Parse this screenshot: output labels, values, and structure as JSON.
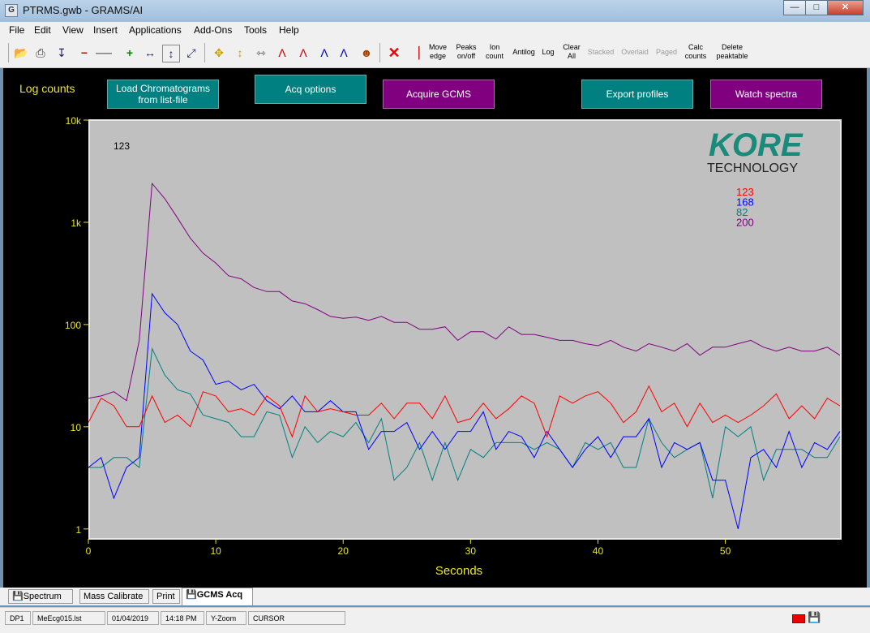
{
  "window": {
    "title": "PTRMS.gwb - GRAMS/AI",
    "app_icon": "G"
  },
  "menu": [
    "File",
    "Edit",
    "View",
    "Insert",
    "Applications",
    "Add-Ons",
    "Tools",
    "Help"
  ],
  "toolbar": {
    "move_edge": "Move edge",
    "peaks": "Peaks on/off",
    "ion_count": "Ion count",
    "antilog": "Antilog",
    "log": "Log",
    "clear_all": "Clear All",
    "stacked": "Stacked",
    "overlaid": "Overlaid",
    "paged": "Paged",
    "calc_counts": "Calc counts",
    "delete_peaktable": "Delete peaktable"
  },
  "panel": {
    "log_counts": "Log counts",
    "btn_load": "Load Chromatograms from list-file",
    "btn_acq": "Acq options",
    "btn_acquire": "Acquire GCMS",
    "btn_export": "Export profiles",
    "btn_watch": "Watch spectra"
  },
  "logo": {
    "line1": "KORE",
    "line2": "TECHNOLOGY"
  },
  "colors": {
    "teal_button": "#008080",
    "purple_button": "#800080",
    "plot_bg": "#c0c0c0",
    "axis_text": "#e8e820"
  },
  "chart_data": {
    "type": "line",
    "title": "",
    "annotation": "123",
    "xlabel": "Seconds",
    "ylabel": "Log counts",
    "yscale": "log",
    "xlim": [
      0,
      59
    ],
    "ylim": [
      0.8,
      10000
    ],
    "x_ticks": [
      "0",
      "10",
      "20",
      "30",
      "40",
      "50"
    ],
    "y_ticks": [
      "1",
      "10",
      "100",
      "1k",
      "10k"
    ],
    "legend_position": "top-right",
    "x": [
      0,
      1,
      2,
      3,
      4,
      5,
      6,
      7,
      8,
      9,
      10,
      11,
      12,
      13,
      14,
      15,
      16,
      17,
      18,
      19,
      20,
      21,
      22,
      23,
      24,
      25,
      26,
      27,
      28,
      29,
      30,
      31,
      32,
      33,
      34,
      35,
      36,
      37,
      38,
      39,
      40,
      41,
      42,
      43,
      44,
      45,
      46,
      47,
      48,
      49,
      50,
      51,
      52,
      53,
      54,
      55,
      56,
      57,
      58,
      59
    ],
    "series": [
      {
        "name": "123",
        "color": "#ff0000",
        "values": [
          11,
          19,
          16,
          10,
          10,
          20,
          11,
          13,
          10,
          22,
          20,
          14,
          15,
          13,
          20,
          16,
          8,
          20,
          14,
          15,
          14,
          13,
          13,
          17,
          12,
          17,
          17,
          12,
          20,
          11,
          12,
          17,
          12,
          15,
          20,
          17,
          8,
          20,
          17,
          20,
          22,
          17,
          11,
          14,
          25,
          14,
          17,
          10,
          17,
          11,
          13,
          11,
          13,
          16,
          21,
          12,
          16,
          12,
          19,
          16
        ]
      },
      {
        "name": "168",
        "color": "#0000ff",
        "values": [
          4,
          5,
          2,
          4,
          5,
          200,
          130,
          100,
          55,
          45,
          26,
          28,
          23,
          26,
          18,
          15,
          20,
          14,
          14,
          18,
          14,
          14,
          6,
          9,
          9,
          11,
          6,
          9,
          6,
          9,
          9,
          14,
          6,
          9,
          8,
          5,
          9,
          6,
          4,
          6,
          8,
          5,
          8,
          8,
          12,
          4,
          7,
          6,
          7,
          3,
          3,
          1,
          5,
          6,
          4,
          9,
          4,
          7,
          6,
          9
        ]
      },
      {
        "name": "82",
        "color": "#008080",
        "values": [
          4,
          4,
          5,
          5,
          4,
          58,
          32,
          23,
          21,
          13,
          12,
          11,
          8,
          8,
          14,
          13,
          5,
          10,
          7,
          9,
          8,
          11,
          7,
          12,
          3,
          4,
          7,
          3,
          7,
          3,
          6,
          5,
          7,
          7,
          7,
          6,
          7,
          6,
          4,
          7,
          6,
          7,
          4,
          4,
          12,
          7,
          5,
          6,
          7,
          2,
          10,
          8,
          10,
          3,
          6,
          6,
          6,
          5,
          5,
          8
        ]
      },
      {
        "name": "200",
        "color": "#800080",
        "values": [
          19,
          20,
          22,
          18,
          70,
          2400,
          1700,
          1100,
          700,
          500,
          400,
          300,
          280,
          230,
          210,
          210,
          170,
          160,
          140,
          120,
          115,
          118,
          110,
          120,
          105,
          105,
          90,
          90,
          95,
          70,
          85,
          85,
          72,
          95,
          80,
          80,
          75,
          70,
          70,
          65,
          62,
          70,
          60,
          55,
          65,
          60,
          55,
          65,
          50,
          60,
          60,
          65,
          70,
          60,
          55,
          60,
          55,
          55,
          60,
          50
        ]
      }
    ]
  },
  "tabs": [
    "Spectrum",
    "Mass Calibrate",
    "Print",
    "GCMS Acq"
  ],
  "status": {
    "dp": "DP1",
    "file": "MeEcg015.lst",
    "date": "01/04/2019",
    "time": "14:18 PM",
    "zoom": "Y-Zoom",
    "mode": "CURSOR"
  }
}
